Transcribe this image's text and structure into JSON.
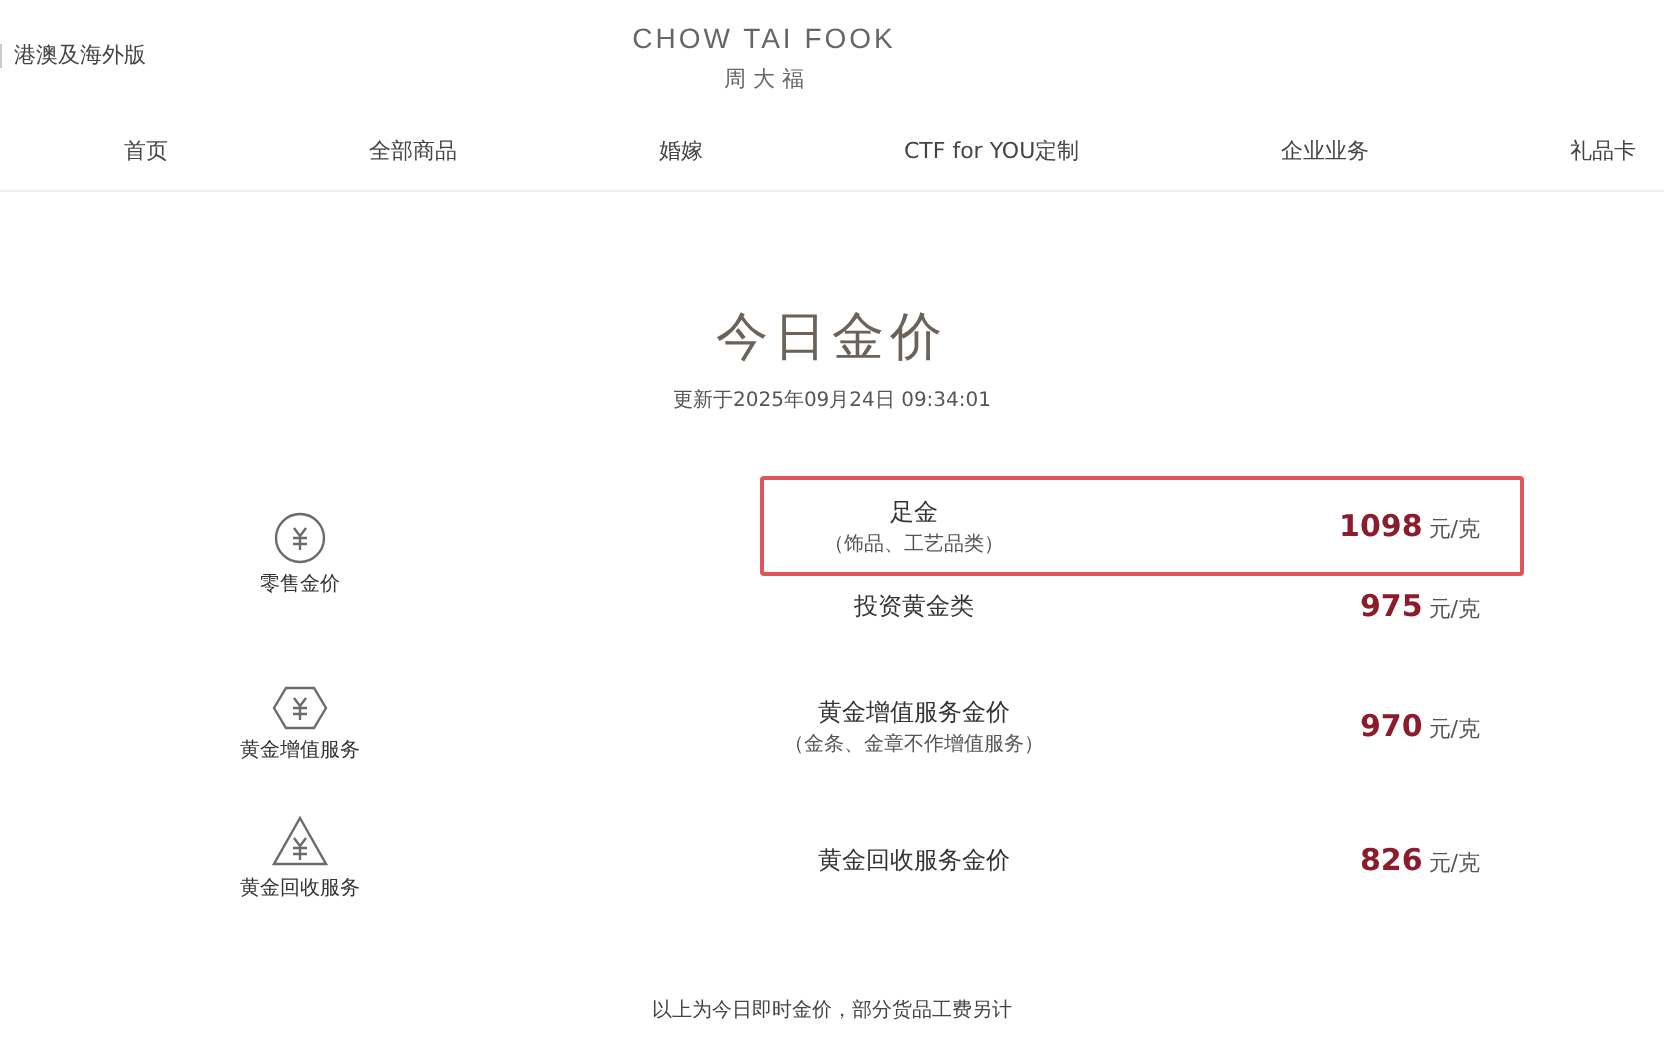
{
  "header": {
    "region": "港澳及海外版",
    "logo_en": "CHOW TAI FOOK",
    "logo_cn": "周 大 福"
  },
  "nav": [
    "首页",
    "全部商品",
    "婚嫁",
    "CTF for YOU定制",
    "企业业务",
    "礼品卡"
  ],
  "title": "今日金价",
  "updated": "更新于2025年09月24日 09:34:01",
  "sections": [
    {
      "label": "零售金价",
      "kind": "circle",
      "items": [
        {
          "name": "足金",
          "note": "（饰品、工艺品类）",
          "price": "1098",
          "unit": "元/克",
          "highlighted": true
        },
        {
          "name": "投资黄金类",
          "price": "975",
          "unit": "元/克",
          "highlighted": false
        }
      ]
    },
    {
      "label": "黄金增值服务",
      "kind": "hexagon",
      "items": [
        {
          "name": "黄金增值服务金价",
          "note": "（金条、金章不作增值服务）",
          "price": "970",
          "unit": "元/克",
          "highlighted": false
        }
      ]
    },
    {
      "label": "黄金回收服务",
      "kind": "triangle",
      "items": [
        {
          "name": "黄金回收服务金价",
          "price": "826",
          "unit": "元/克",
          "highlighted": false
        }
      ]
    }
  ],
  "footnote": "以上为今日即时金价，部分货品工费另计"
}
